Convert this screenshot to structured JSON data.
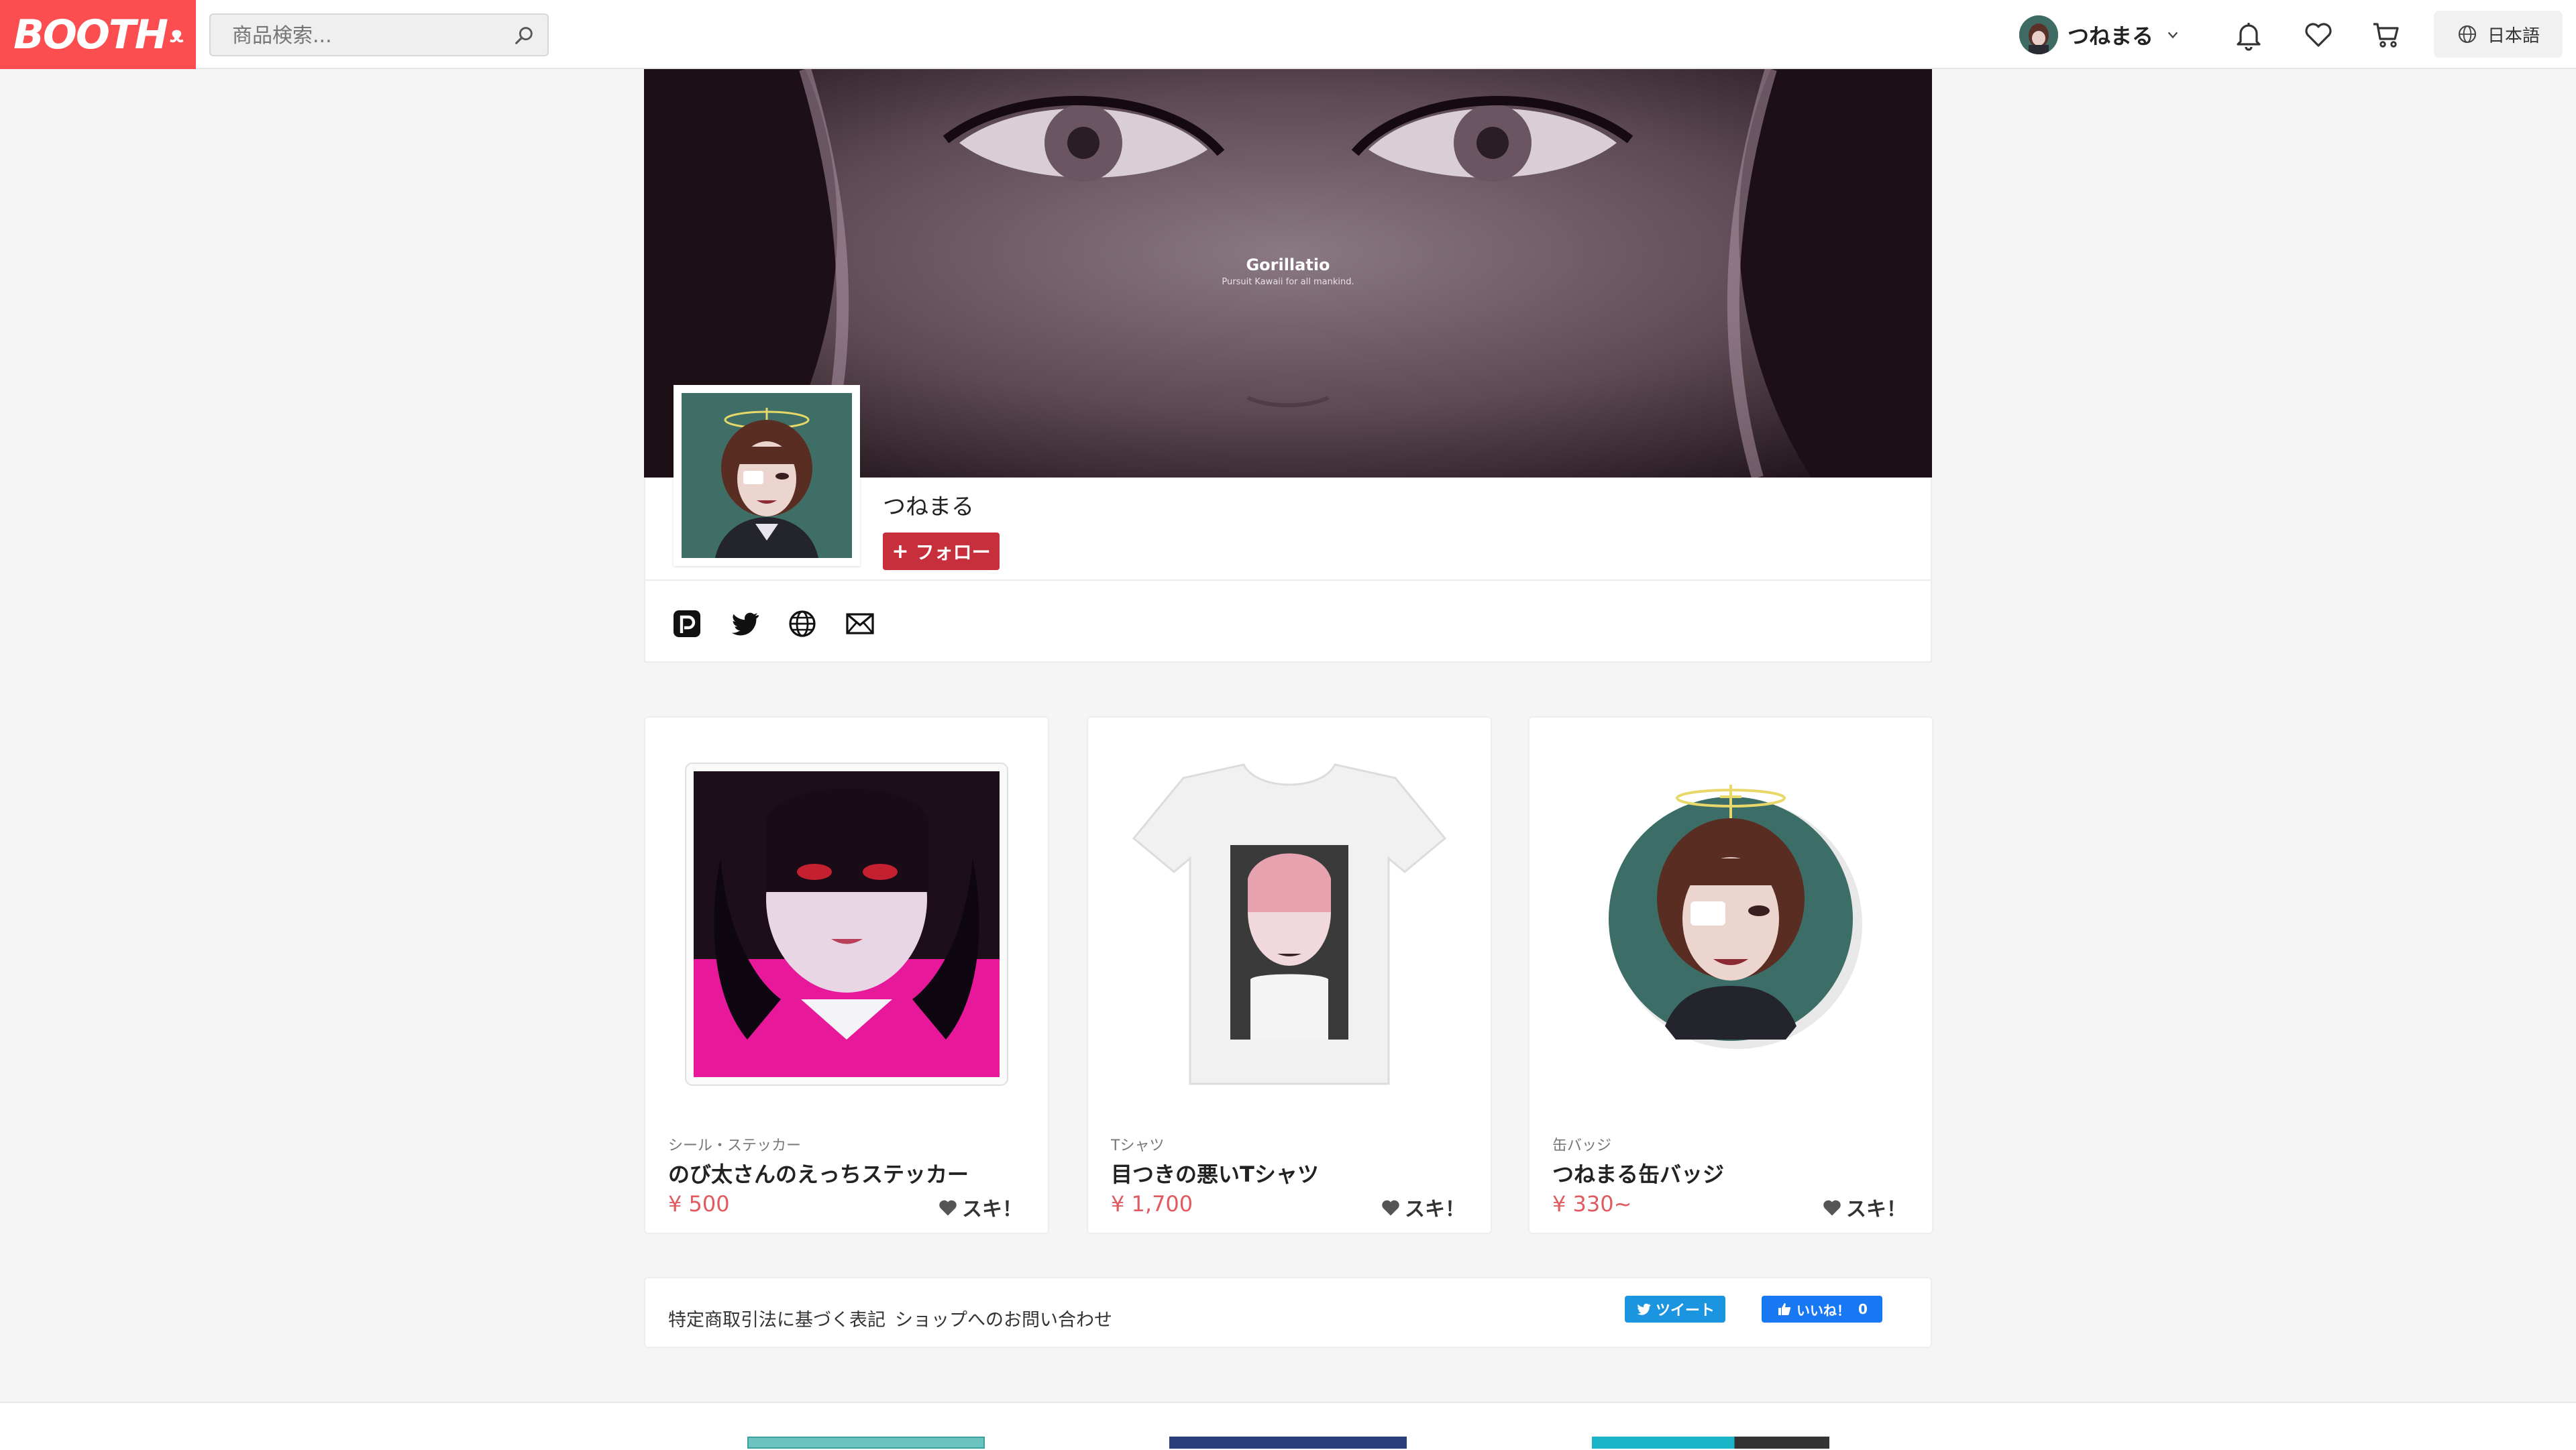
{
  "header": {
    "logo_text": "BOOTH",
    "search_placeholder": "商品検索...",
    "user_name": "つねまる",
    "language": "日本語",
    "icons": [
      "bell-icon",
      "heart-icon",
      "cart-icon",
      "globe-icon"
    ]
  },
  "banner": {
    "title": "Gorillatio",
    "subtitle": "Pursuit Kawaii for all mankind."
  },
  "profile": {
    "shop_name": "つねまる",
    "follow_label": "フォロー",
    "social_icons": [
      "pixiv-icon",
      "twitter-icon",
      "website-icon",
      "mail-icon"
    ]
  },
  "products": [
    {
      "category": "シール・ステッカー",
      "title": "のび太さんのえっちステッカー",
      "price": "¥ 500",
      "like": "スキ！"
    },
    {
      "category": "Tシャツ",
      "title": "目つきの悪いTシャツ",
      "price": "¥ 1,700",
      "like": "スキ！"
    },
    {
      "category": "缶バッジ",
      "title": "つねまる缶バッジ",
      "price": "¥ 330~",
      "like": "スキ！"
    }
  ],
  "footer": {
    "legal_link": "特定商取引法に基づく表記",
    "contact_link": "ショップへのお問い合わせ",
    "tweet_label": "ツイート",
    "like_label": "いいね！",
    "like_count": "0"
  },
  "colors": {
    "brand": "#fc4d50",
    "follow": "#c62f3b",
    "price": "#e05a5f",
    "twitter": "#1b95e0",
    "facebook": "#1877f2"
  }
}
